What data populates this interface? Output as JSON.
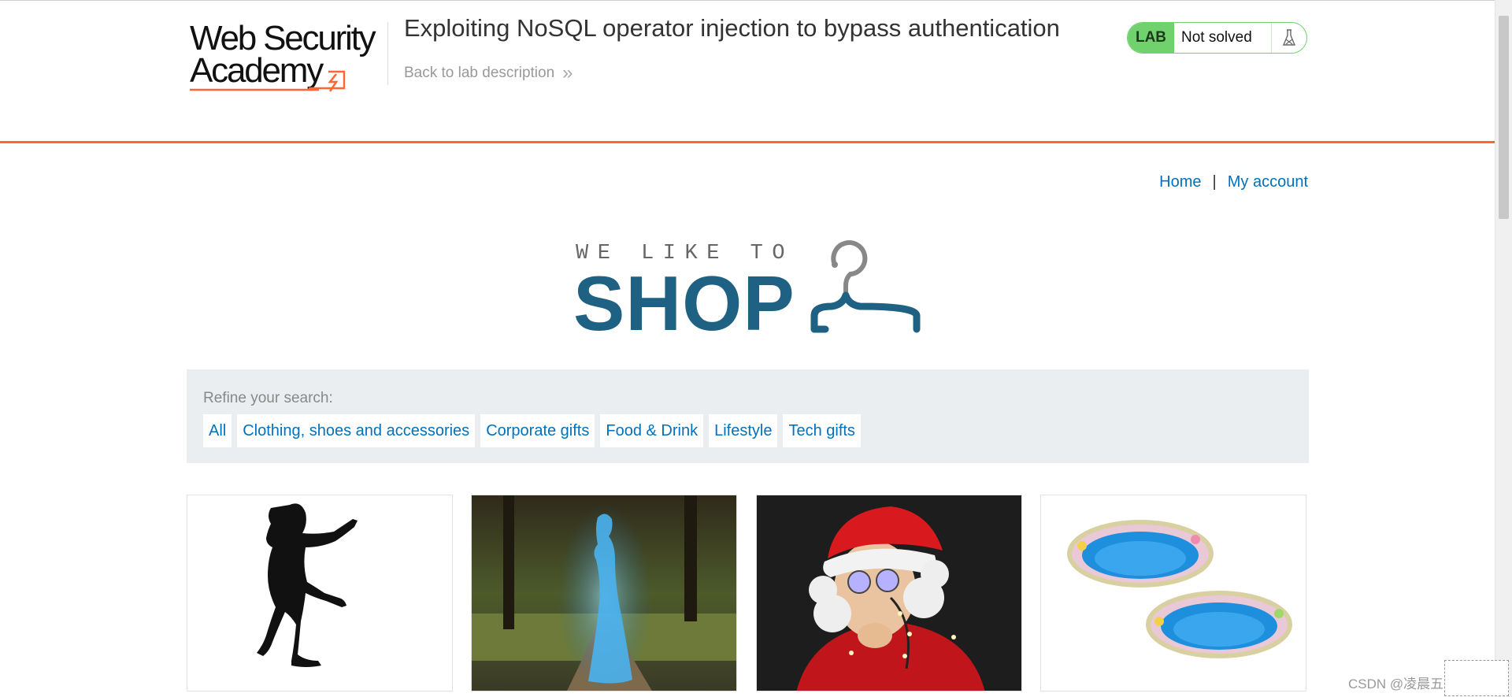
{
  "academy": {
    "logo_line1": "Web Security",
    "logo_line2": "Academy",
    "lab_title": "Exploiting NoSQL operator injection to bypass authentication",
    "back_link": "Back to lab description",
    "lab_badge": "LAB",
    "lab_state": "Not solved",
    "flask_icon": "flask-icon",
    "chevron_icon": "double-chevron-right-icon"
  },
  "nav": {
    "home": "Home",
    "separator": "|",
    "account": "My account"
  },
  "shop_logo": {
    "tagline": "WE LIKE TO",
    "word": "SHOP",
    "icon": "hanger-icon"
  },
  "filters": {
    "label": "Refine your search:",
    "categories": [
      "All",
      "Clothing, shoes and accessories",
      "Corporate gifts",
      "Food & Drink",
      "Lifestyle",
      "Tech gifts"
    ]
  },
  "products": [
    {
      "image": "silhouette-figure-image"
    },
    {
      "image": "glowing-ghost-woman-in-park-image"
    },
    {
      "image": "man-in-santa-hat-with-fairy-lights-image"
    },
    {
      "image": "two-inflatable-paddling-pools-image"
    }
  ],
  "colors": {
    "accent_orange": "#ff6633",
    "link_blue": "#0071bc",
    "lab_green": "#70d16d",
    "shop_blue": "#1f6183"
  },
  "watermark": "CSDN @凌晨五点的星"
}
